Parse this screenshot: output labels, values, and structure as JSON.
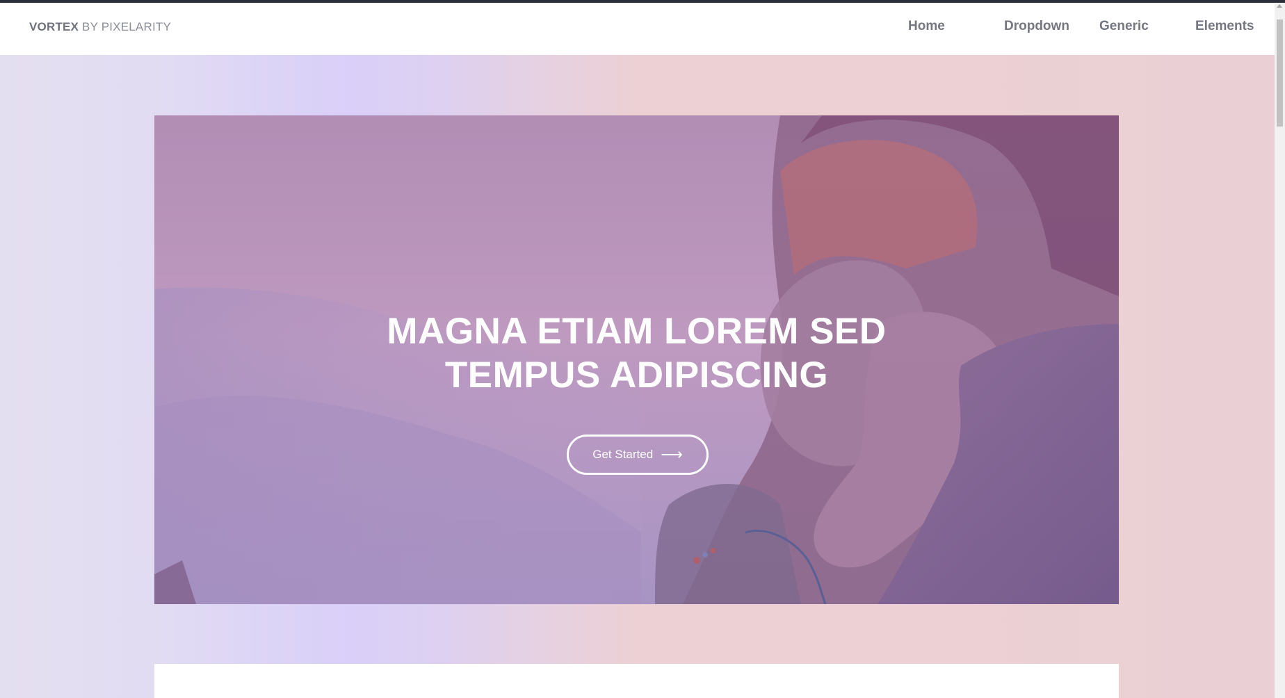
{
  "brand": {
    "strong": "VORTEX",
    "rest": "BY PIXELARITY"
  },
  "nav": {
    "home": "Home",
    "dropdown": "Dropdown",
    "generic": "Generic",
    "elements": "Elements"
  },
  "hero": {
    "title_line1": "MAGNA ETIAM LOREM SED",
    "title_line2": "TEMPUS ADIPISCING",
    "cta_label": "Get Started",
    "cta_arrow": "⟶"
  },
  "colors": {
    "nav_text": "#747680",
    "brand_text": "#8a8c96",
    "hero_text": "#ffffff",
    "background_gradient_start": "#e4dff0",
    "background_gradient_end": "#ead0d4"
  }
}
